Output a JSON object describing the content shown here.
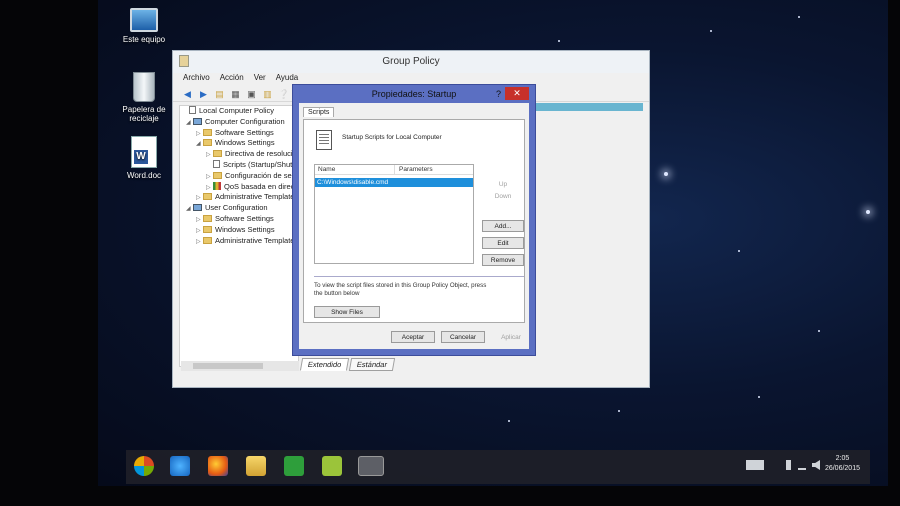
{
  "desktop": {
    "icons": [
      {
        "label": "Este equipo",
        "icon": "computer-icon"
      },
      {
        "label": "Papelera de\nreciclaje",
        "icon": "recycle-bin-icon"
      },
      {
        "label": "Word.doc",
        "icon": "word-document-icon"
      }
    ]
  },
  "gp_window": {
    "title": "Group Policy",
    "menu": [
      "Archivo",
      "Acción",
      "Ver",
      "Ayuda"
    ],
    "toolbar_icons": [
      "back-arrow-icon",
      "forward-arrow-icon",
      "up-folder-icon",
      "show-tree-icon",
      "properties-icon",
      "export-icon",
      "help-icon"
    ],
    "tree": [
      {
        "label": "Local Computer Policy",
        "level": 0,
        "icon": "document-icon"
      },
      {
        "label": "Computer Configuration",
        "level": 1,
        "icon": "computer-icon"
      },
      {
        "label": "Software Settings",
        "level": 2,
        "icon": "folder-icon"
      },
      {
        "label": "Windows Settings",
        "level": 2,
        "icon": "folder-icon"
      },
      {
        "label": "Directiva de resolución",
        "level": 3,
        "icon": "folder-icon"
      },
      {
        "label": "Scripts (Startup/Shutdown)",
        "level": 3,
        "icon": "document-icon"
      },
      {
        "label": "Configuración de seguridad",
        "level": 3,
        "icon": "folder-icon"
      },
      {
        "label": "QoS basada en directiva",
        "level": 3,
        "icon": "chart-icon"
      },
      {
        "label": "Administrative Templates",
        "level": 2,
        "icon": "folder-icon"
      },
      {
        "label": "User Configuration",
        "level": 1,
        "icon": "computer-icon"
      },
      {
        "label": "Software Settings",
        "level": 2,
        "icon": "folder-icon"
      },
      {
        "label": "Windows Settings",
        "level": 2,
        "icon": "folder-icon"
      },
      {
        "label": "Administrative Templates",
        "level": 2,
        "icon": "folder-icon"
      }
    ],
    "tabs": [
      "Extendido",
      "Estándar"
    ],
    "active_tab": "Extendido"
  },
  "dialog": {
    "title": "Propiedades: Startup",
    "help": "?",
    "close": "✕",
    "tab": "Scripts",
    "header_text": "Startup Scripts for Local Computer",
    "columns": [
      "Name",
      "Parameters"
    ],
    "rows": [
      {
        "name": "C:\\Windows\\disable.cmd",
        "parameters": ""
      }
    ],
    "side_buttons": [
      {
        "label": "Up",
        "enabled": false
      },
      {
        "label": "Down",
        "enabled": false
      },
      {
        "label": "Add...",
        "enabled": true
      },
      {
        "label": "Edit",
        "enabled": true
      },
      {
        "label": "Remove",
        "enabled": true
      }
    ],
    "note": "To view the script files stored in this Group Policy Object, press the button below",
    "show_files": "Show Files",
    "footer": [
      {
        "label": "Aceptar",
        "enabled": true
      },
      {
        "label": "Cancelar",
        "enabled": true
      },
      {
        "label": "Aplicar",
        "enabled": false
      }
    ]
  },
  "taskbar": {
    "apps": [
      "start-button",
      "internet-explorer-icon",
      "firefox-icon",
      "file-explorer-icon",
      "store-icon",
      "android-icon",
      "group-policy-icon"
    ],
    "clock_time": "2:05",
    "clock_date": "26/06/2015",
    "colors": {
      "accent": "#1e8fdb",
      "dialog_frame": "#5b6fc2",
      "close": "#c7302a"
    }
  }
}
